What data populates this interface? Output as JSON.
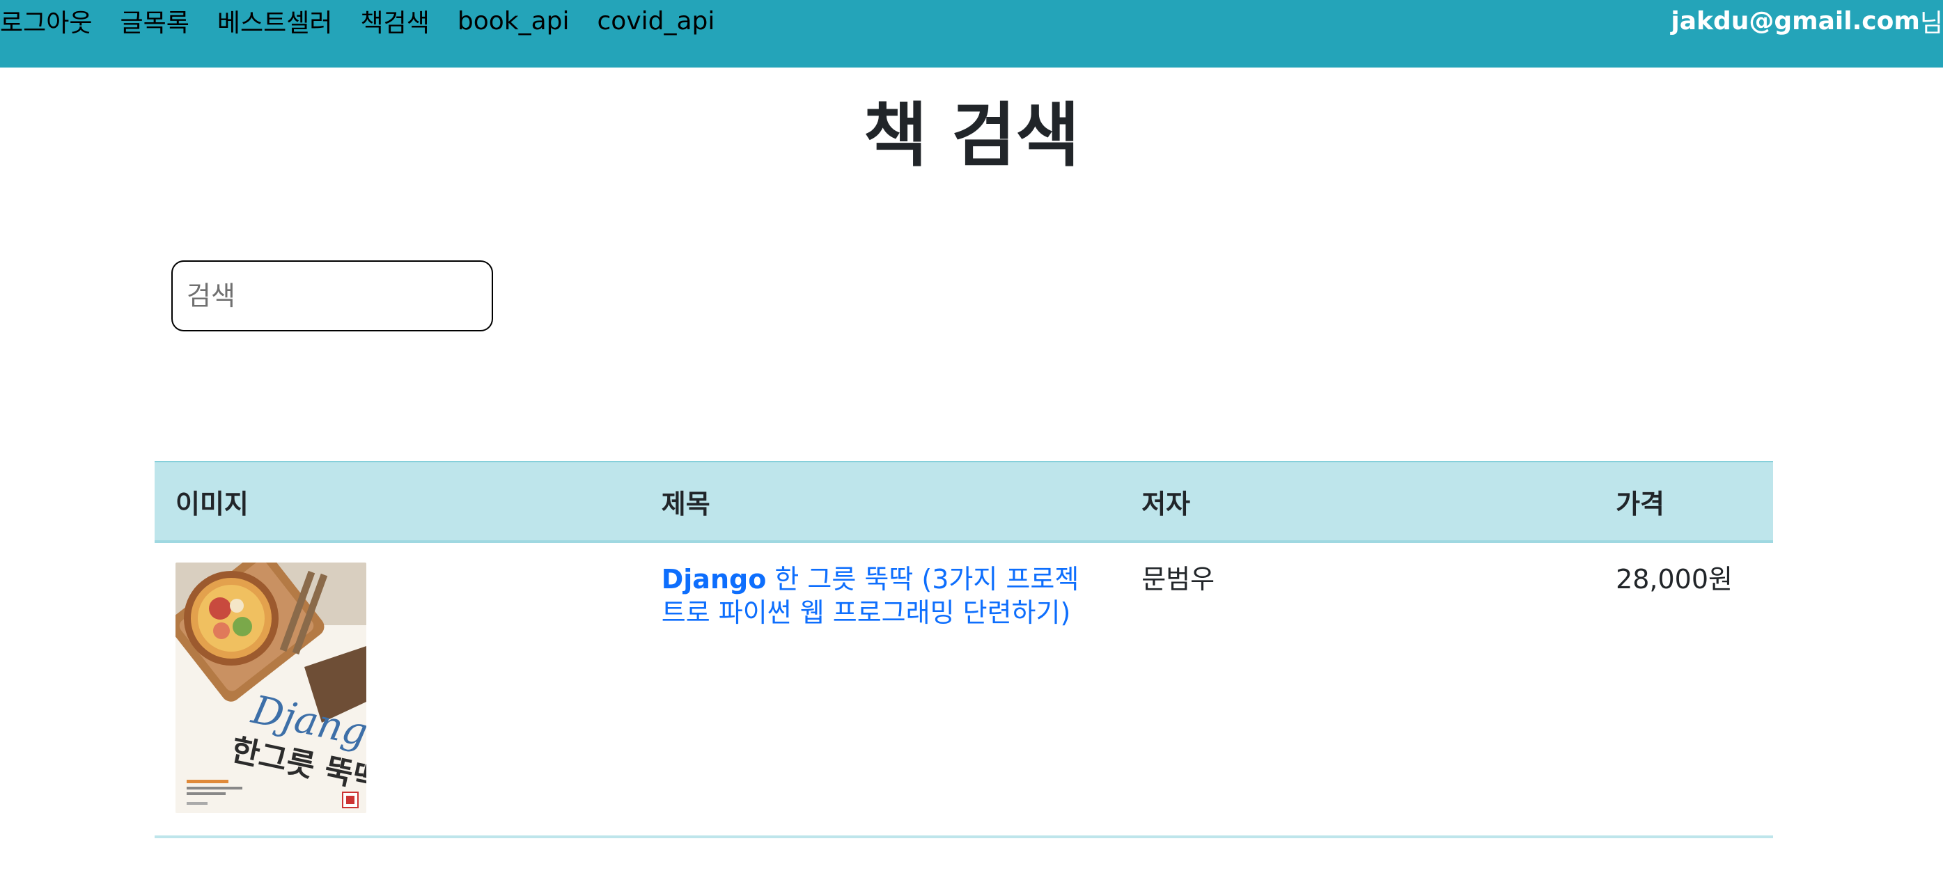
{
  "nav": {
    "links": [
      "로그아웃",
      "글목록",
      "베스트셀러",
      "책검색",
      "book_api",
      "covid_api"
    ],
    "user_email": "jakdu@gmail.com",
    "user_suffix": "님"
  },
  "page": {
    "title": "책 검색"
  },
  "search": {
    "placeholder": "검색",
    "value": ""
  },
  "table": {
    "headers": [
      "이미지",
      "제목",
      "저자",
      "가격"
    ],
    "rows": [
      {
        "title_bold": "Django",
        "title_rest": " 한 그릇 뚝딱 (3가지 프로젝트로 파이썬 웹 프로그래밍 단련하기)",
        "author": "문범우",
        "price": "28,000원",
        "cover": {
          "title_latin": "Django",
          "title_korean": "한그릇 뚝딱"
        }
      }
    ]
  },
  "colors": {
    "navbar": "#24a4b9",
    "table_header": "#bee5eb",
    "link": "#0d6efd"
  }
}
